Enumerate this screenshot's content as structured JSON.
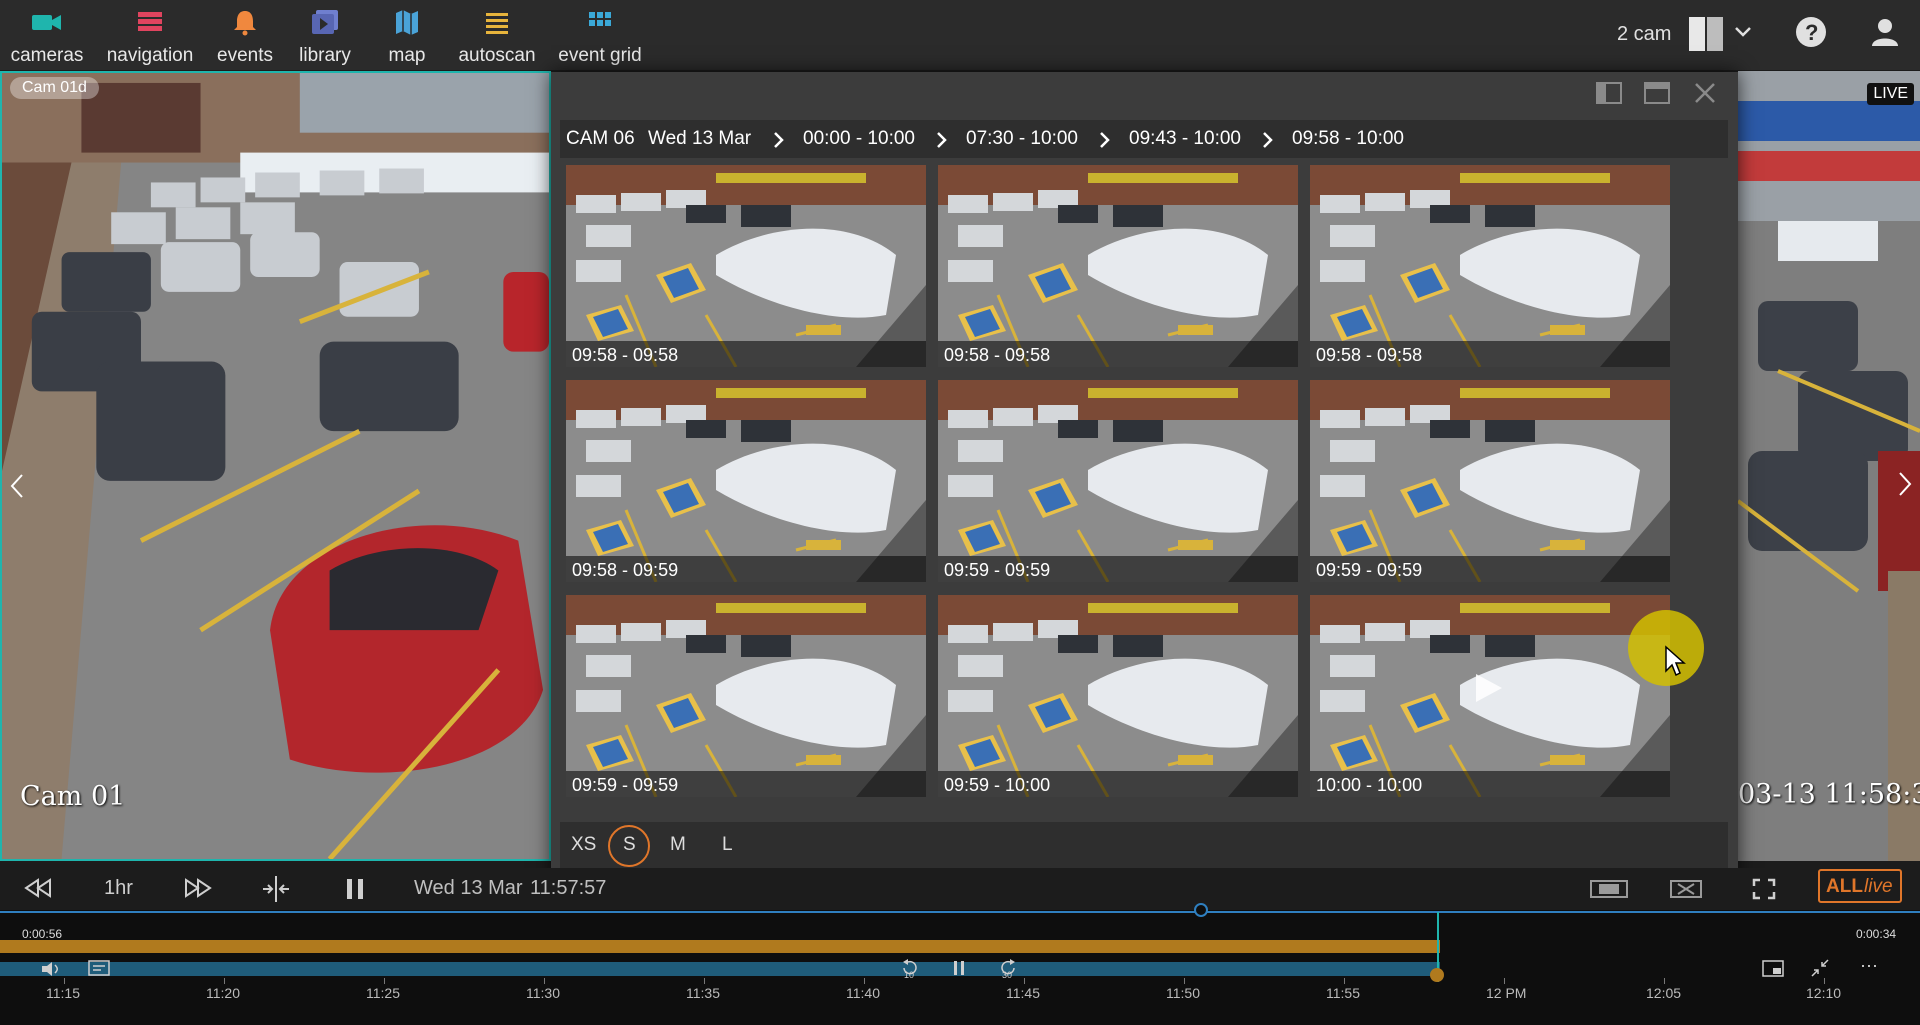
{
  "nav": [
    {
      "label": "cameras",
      "icon": "camera-icon",
      "color": "#1fb5ad"
    },
    {
      "label": "navigation",
      "icon": "grid-icon",
      "color": "#e0445f"
    },
    {
      "label": "events",
      "icon": "bell-icon",
      "color": "#f0883e"
    },
    {
      "label": "library",
      "icon": "library-icon",
      "color": "#6f7fcf"
    },
    {
      "label": "map",
      "icon": "map-icon",
      "color": "#4aa3d8"
    },
    {
      "label": "autoscan",
      "icon": "list-icon",
      "color": "#e7b43c"
    },
    {
      "label": "event grid",
      "icon": "event-grid-icon",
      "color": "#3ba9d8"
    }
  ],
  "header_right": {
    "cam_count": "2 cam",
    "help": "?"
  },
  "cams": {
    "left_label_top": "Cam 01d",
    "left_label_bottom": "Cam 01",
    "right_badge": "LIVE",
    "right_timestamp": "03-13 11:58:37"
  },
  "panel": {
    "breadcrumb": [
      "CAM 06",
      "Wed 13 Mar",
      "00:00 - 10:00",
      "07:30 - 10:00",
      "09:43 - 10:00",
      "09:58 - 10:00"
    ],
    "thumbs": [
      "09:58 - 09:58",
      "09:58 - 09:58",
      "09:58 - 09:58",
      "09:58 - 09:59",
      "09:59 - 09:59",
      "09:59 - 09:59",
      "09:59 - 09:59",
      "09:59 - 10:00",
      "10:00 - 10:00"
    ],
    "sizes": [
      "XS",
      "S",
      "M",
      "L"
    ],
    "selected_size": "S"
  },
  "transport": {
    "span": "1hr",
    "date": "Wed 13 Mar",
    "time": "11:57:57",
    "all": "ALL",
    "live": "live",
    "accent": "#e0762a"
  },
  "timeline": {
    "elapsed": "0:00:56",
    "remaining": "0:00:34",
    "rewind": "10",
    "forward": "30",
    "ticks": [
      "11:15",
      "11:20",
      "11:25",
      "11:30",
      "11:35",
      "11:40",
      "11:45",
      "11:50",
      "11:55",
      "12 PM",
      "12:05",
      "12:10"
    ]
  }
}
